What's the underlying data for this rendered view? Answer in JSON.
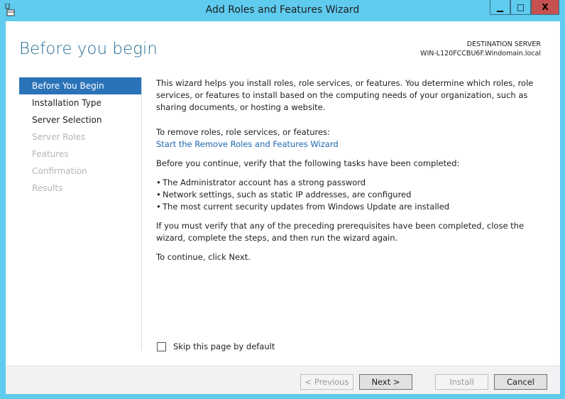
{
  "window": {
    "title": "Add Roles and Features Wizard",
    "minimize": "▁",
    "maximize": "□",
    "close": "X"
  },
  "header": {
    "heading": "Before you begin",
    "destination_label": "DESTINATION SERVER",
    "destination_server": "WIN-L120FCCBU6F.Windomain.local"
  },
  "nav": {
    "items": [
      {
        "label": "Before You Begin",
        "state": "active"
      },
      {
        "label": "Installation Type",
        "state": "enabled"
      },
      {
        "label": "Server Selection",
        "state": "enabled"
      },
      {
        "label": "Server Roles",
        "state": "disabled"
      },
      {
        "label": "Features",
        "state": "disabled"
      },
      {
        "label": "Confirmation",
        "state": "disabled"
      },
      {
        "label": "Results",
        "state": "disabled"
      }
    ]
  },
  "content": {
    "intro": "This wizard helps you install roles, role services, or features. You determine which roles, role services, or features to install based on the computing needs of your organization, such as sharing documents, or hosting a website.",
    "remove_text": "To remove roles, role services, or features:",
    "remove_link": "Start the Remove Roles and Features Wizard",
    "verify_text": "Before you continue, verify that the following tasks have been completed:",
    "bullets": [
      "The Administrator account has a strong password",
      "Network settings, such as static IP addresses, are configured",
      "The most current security updates from Windows Update are installed"
    ],
    "prereq_text": "If you must verify that any of the preceding prerequisites have been completed, close the wizard, complete the steps, and then run the wizard again.",
    "continue_text": "To continue, click Next."
  },
  "skip": {
    "label": "Skip this page by default",
    "checked": false
  },
  "footer": {
    "previous": "< Previous",
    "next": "Next >",
    "install": "Install",
    "cancel": "Cancel"
  },
  "colors": {
    "frame": "#5ecbef",
    "accent": "#2a73b8",
    "close": "#c75050",
    "link": "#1f66b1"
  }
}
